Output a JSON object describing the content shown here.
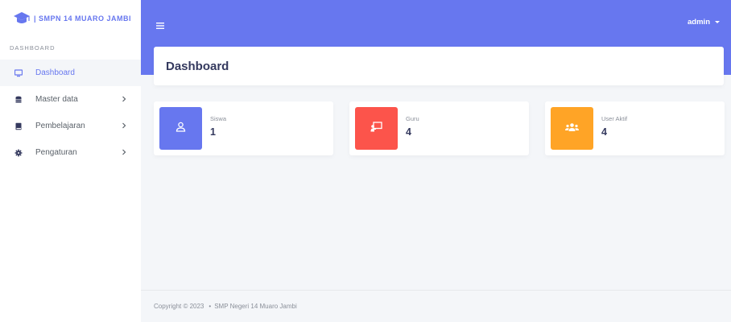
{
  "brand": {
    "name": "| SMPN 14 MUARO JAMBI",
    "icon": "graduation-cap-icon",
    "color": "#6777ef"
  },
  "sidebar": {
    "section_header": "DASHBOARD",
    "items": [
      {
        "label": "Dashboard",
        "icon": "monitor-icon",
        "active": true,
        "has_submenu": false
      },
      {
        "label": "Master data",
        "icon": "database-icon",
        "active": false,
        "has_submenu": true
      },
      {
        "label": "Pembelajaran",
        "icon": "book-icon",
        "active": false,
        "has_submenu": true
      },
      {
        "label": "Pengaturan",
        "icon": "cog-icon",
        "active": false,
        "has_submenu": true
      }
    ]
  },
  "topbar": {
    "menu_icon": "hamburger-icon",
    "user": "admin",
    "color": "#6777ef"
  },
  "page": {
    "title": "Dashboard"
  },
  "stats": [
    {
      "label": "Siswa",
      "value": "1",
      "icon": "user-icon",
      "color": "#6777ef"
    },
    {
      "label": "Guru",
      "value": "4",
      "icon": "chalkboard-teacher-icon",
      "color": "#fc544b"
    },
    {
      "label": "User Aktif",
      "value": "4",
      "icon": "users-icon",
      "color": "#ffa426"
    }
  ],
  "footer": {
    "copyright": "Copyright © 2023",
    "org": "SMP Negeri 14 Muaro Jambi"
  }
}
